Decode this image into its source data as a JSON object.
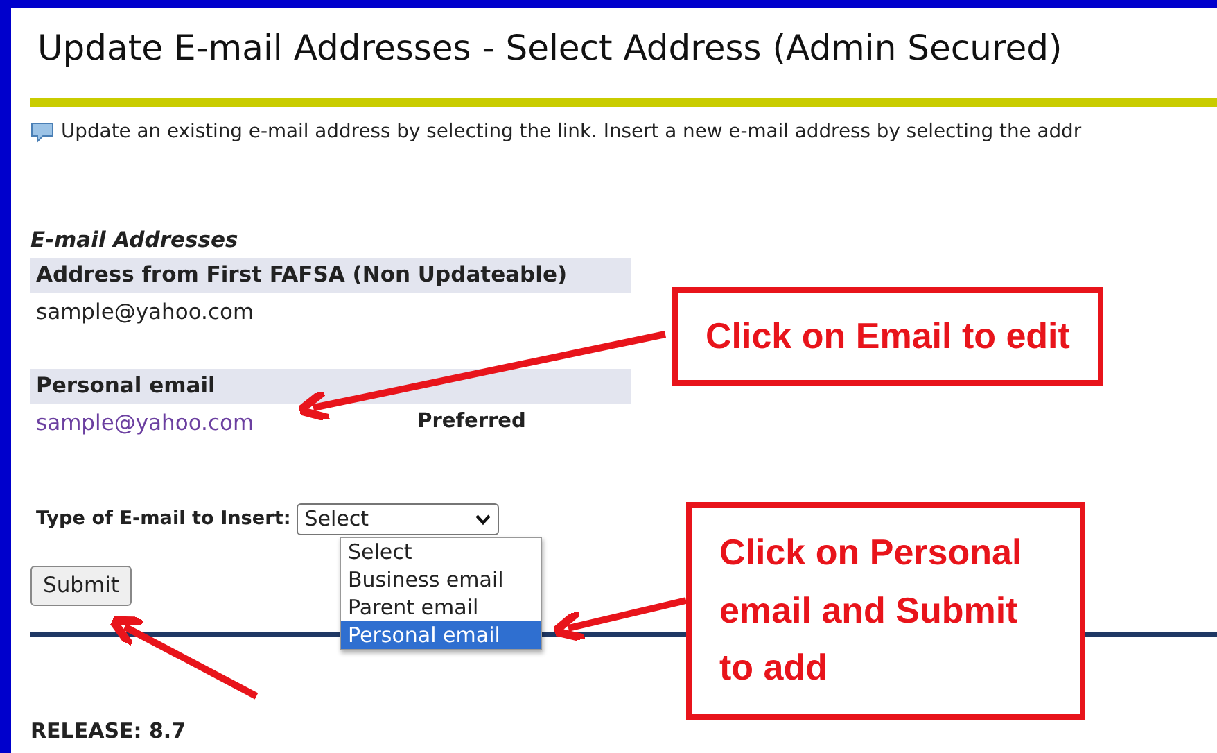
{
  "page_title": "Update E-mail Addresses - Select Address (Admin Secured)",
  "info_text": "Update an existing e-mail address by selecting the link. Insert a new e-mail address by selecting the addr",
  "section_heading": "E-mail Addresses",
  "address_groups": [
    {
      "heading": "Address from First FAFSA (Non Updateable)",
      "email": "sample@yahoo.com",
      "kind": "text"
    },
    {
      "heading": "Personal email",
      "email": "sample@yahoo.com",
      "kind": "link",
      "tag": "Preferred"
    }
  ],
  "insert": {
    "label": "Type of E-mail to Insert:",
    "value": "Select",
    "expanded": true,
    "options": [
      {
        "label": "Select",
        "highlighted": false
      },
      {
        "label": "Business email",
        "highlighted": false
      },
      {
        "label": "Parent email",
        "highlighted": false
      },
      {
        "label": "Personal email",
        "highlighted": true
      }
    ]
  },
  "submit_button": "Submit",
  "release": "RELEASE: 8.7",
  "callouts": [
    "Click on Email to edit",
    "Click on Personal email and Submit to add"
  ]
}
